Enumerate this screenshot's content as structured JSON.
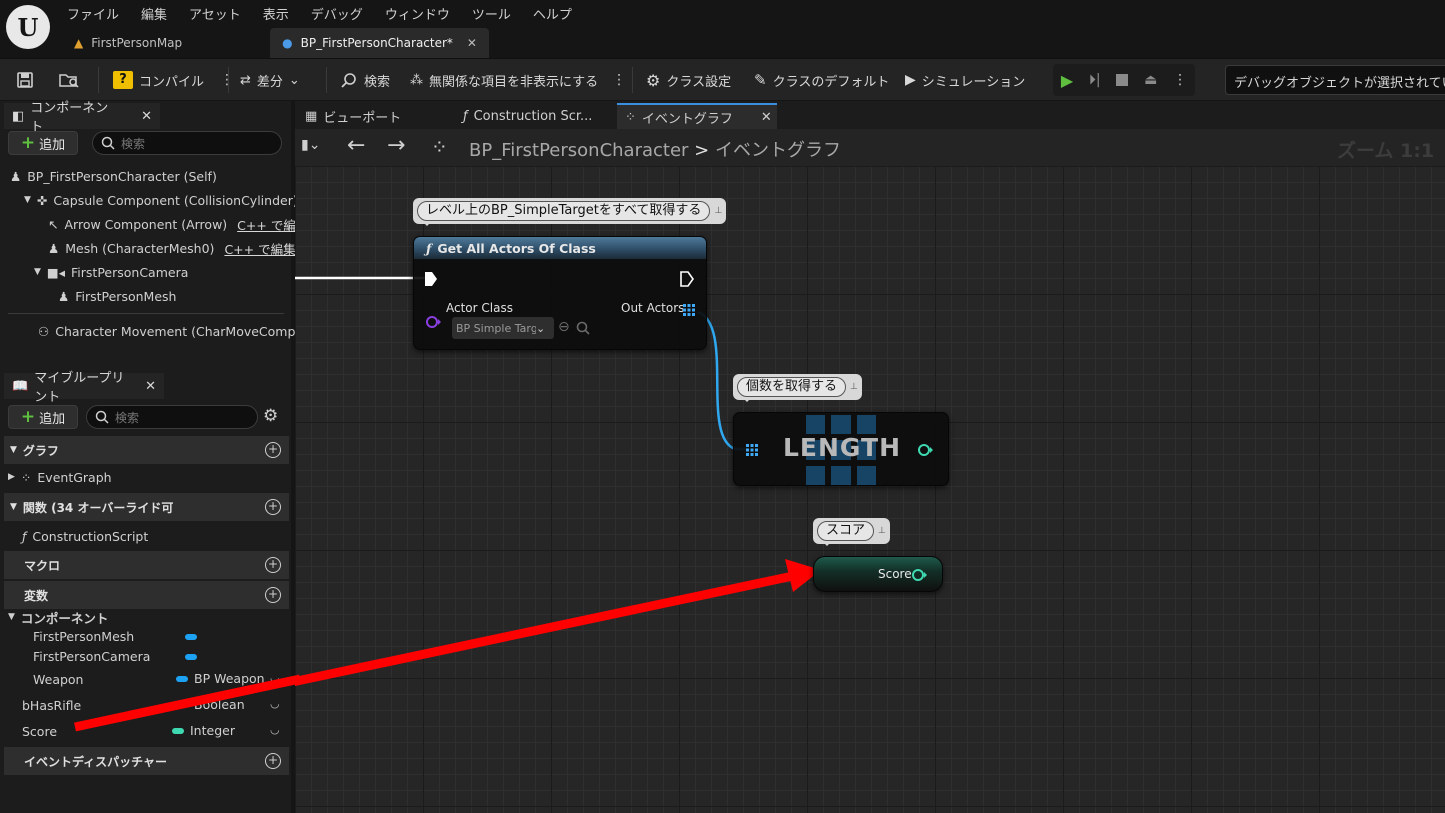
{
  "menu": [
    "ファイル",
    "編集",
    "アセット",
    "表示",
    "デバッグ",
    "ウィンドウ",
    "ツール",
    "ヘルプ"
  ],
  "doc_tabs": [
    {
      "label": "FirstPersonMap"
    },
    {
      "label": "BP_FirstPersonCharacter*"
    }
  ],
  "toolbar": {
    "compile": "コンパイル",
    "diff": "差分",
    "search": "検索",
    "hide_unrelated": "無関係な項目を非表示にする",
    "class_settings": "クラス設定",
    "class_defaults": "クラスのデフォルト",
    "simulation": "シミュレーション",
    "debug_object": "デバッグオブジェクトが選択されていません"
  },
  "components_panel": {
    "title": "コンポーネント",
    "add": "追加",
    "search_placeholder": "検索",
    "items": [
      "BP_FirstPersonCharacter (Self)",
      "Capsule Component (CollisionCylinder)",
      "Arrow Component (Arrow)",
      "Mesh (CharacterMesh0)",
      "FirstPersonCamera",
      "FirstPersonMesh",
      "Character Movement (CharMoveComp)"
    ],
    "cpp_edit": "C++ で編集"
  },
  "blueprint_panel": {
    "title": "マイブループリント",
    "add": "追加",
    "search_placeholder": "検索",
    "graph_section": "グラフ",
    "event_graph": "EventGraph",
    "functions_section": "関数 (34 オーバーライド可",
    "construction_script": "ConstructionScript",
    "macros_section": "マクロ",
    "variables_section": "変数",
    "components_group": "コンポーネント",
    "variables": [
      {
        "name": "FirstPersonMesh",
        "type": ""
      },
      {
        "name": "FirstPersonCamera",
        "type": ""
      },
      {
        "name": "Weapon",
        "type": "BP Weapon"
      },
      {
        "name": "bHasRifle",
        "type": "Boolean"
      },
      {
        "name": "Score",
        "type": "Integer"
      }
    ],
    "dispatchers_section": "イベントディスパッチャー"
  },
  "graph_tabs": [
    "ビューポート",
    "Construction Scr...",
    "イベントグラフ"
  ],
  "breadcrumb": {
    "root": "BP_FirstPersonCharacter",
    "current": "イベントグラフ"
  },
  "zoom": "ズーム 1:1",
  "nodes": {
    "get_all": {
      "comment": "レベル上のBP_SimpleTargetをすべて取得する",
      "title": "Get All Actors Of Class",
      "actor_class_label": "Actor Class",
      "actor_class_value": "BP Simple Targ",
      "out_actors": "Out Actors"
    },
    "length": {
      "comment": "個数を取得する",
      "title": "LENGTH"
    },
    "score": {
      "comment": "スコア",
      "label": "Score"
    }
  },
  "colors": {
    "exec": "#ffffff",
    "array_pin": "#3fa9f5",
    "integer_pin": "#3ed9b0",
    "class_pin": "#8a3fe0",
    "annotation_arrow": "#ff0000"
  }
}
